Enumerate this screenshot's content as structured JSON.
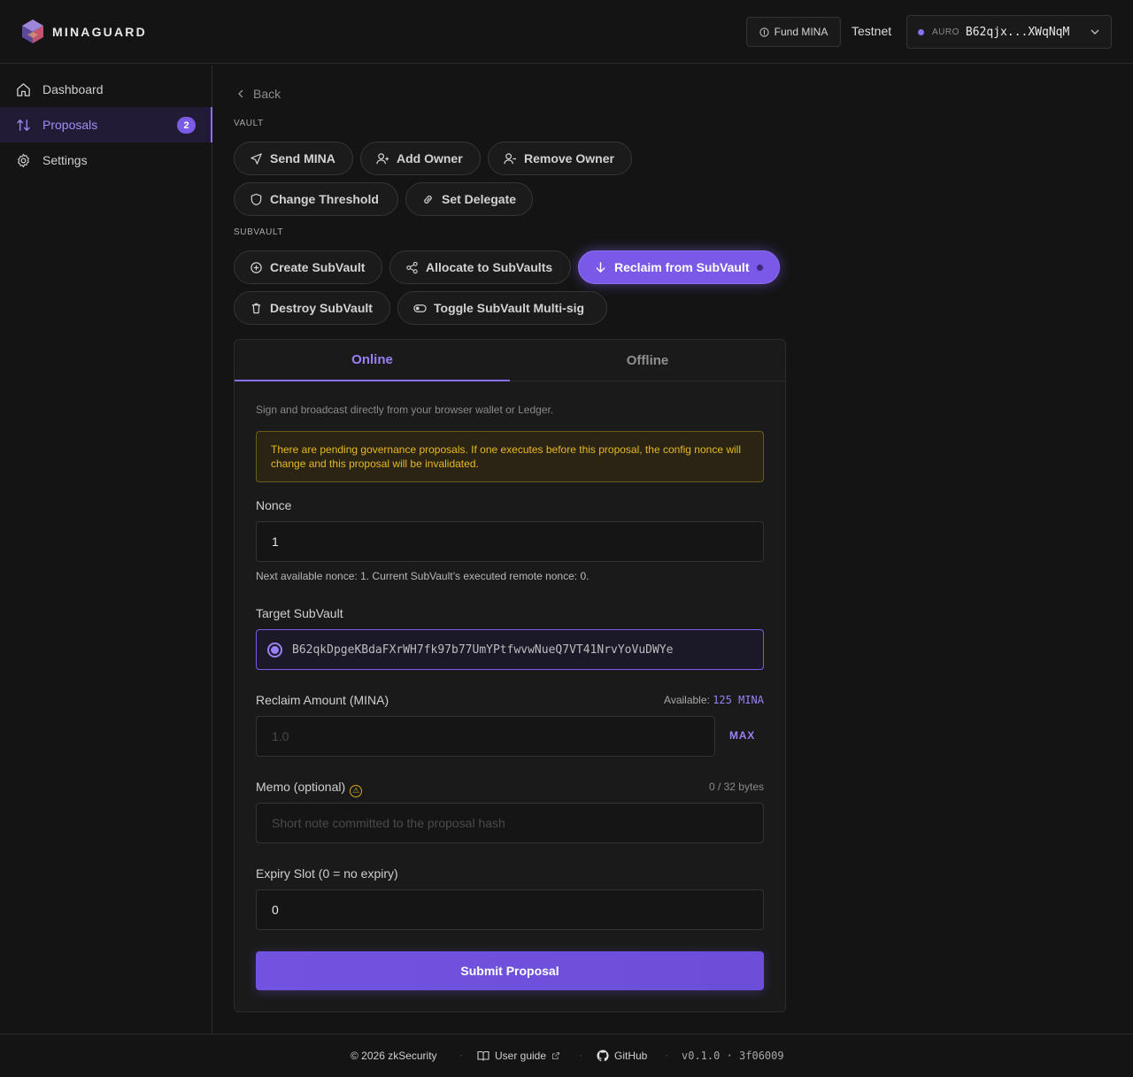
{
  "header": {
    "logo_text": "MINAGUARD",
    "fund_label": "Fund MINA",
    "network": "Testnet",
    "wallet_tag": "AURO",
    "wallet_address": "B62qjx...XWqNqM",
    "accent_color": "#8b6ff0"
  },
  "sidebar": {
    "items": [
      {
        "label": "Dashboard",
        "icon": "home-icon"
      },
      {
        "label": "Proposals",
        "icon": "arrows-icon",
        "badge": "2"
      },
      {
        "label": "Settings",
        "icon": "gear-icon"
      }
    ]
  },
  "main": {
    "back_label": "Back",
    "vault_label": "VAULT",
    "subvault_label": "SUBVAULT",
    "vault_actions": [
      {
        "label": "Send MINA",
        "icon": "send-icon"
      },
      {
        "label": "Add Owner",
        "icon": "user-plus-icon"
      },
      {
        "label": "Remove Owner",
        "icon": "user-minus-icon"
      },
      {
        "label": "Change Threshold",
        "icon": "shield-icon"
      },
      {
        "label": "Set Delegate",
        "icon": "link-icon"
      }
    ],
    "subvault_actions": [
      {
        "label": "Create SubVault",
        "icon": "plus-circle-icon"
      },
      {
        "label": "Allocate to SubVaults",
        "icon": "share-icon"
      },
      {
        "label": "Reclaim from SubVault",
        "icon": "arrow-down-icon",
        "selected": true
      },
      {
        "label": "Destroy SubVault",
        "icon": "trash-icon"
      },
      {
        "label": "Toggle SubVault Multi-sig",
        "icon": "toggle-icon"
      }
    ]
  },
  "form": {
    "tabs": [
      "Online",
      "Offline"
    ],
    "intro": "Sign and broadcast directly from your browser wallet or Ledger.",
    "warning": "There are pending governance proposals. If one executes before this proposal, the config nonce will change and this proposal will be invalidated.",
    "nonce_label": "Nonce",
    "nonce_value": "1",
    "nonce_hint": "Next available nonce: 1. Current SubVault’s executed remote nonce: 0.",
    "target_label": "Target SubVault",
    "target_address": "B62qkDpgeKBdaFXrWH7fk97b77UmYPtfwvwNueQ7VT41NrvYoVuDWYe",
    "amount_label": "Reclaim Amount (MINA)",
    "available_prefix": "Available:",
    "available_value": "125 MINA",
    "amount_placeholder": "1.0",
    "max_label": "MAX",
    "memo_label": "Memo (optional)",
    "memo_bytes": "0 / 32 bytes",
    "memo_placeholder": "Short note committed to the proposal hash",
    "expiry_label": "Expiry Slot (0 = no expiry)",
    "expiry_value": "0",
    "submit_label": "Submit Proposal"
  },
  "footer": {
    "copyright": "© 2026 zkSecurity",
    "guide": "User guide",
    "github": "GitHub",
    "version": "v0.1.0 · 3f06009"
  }
}
